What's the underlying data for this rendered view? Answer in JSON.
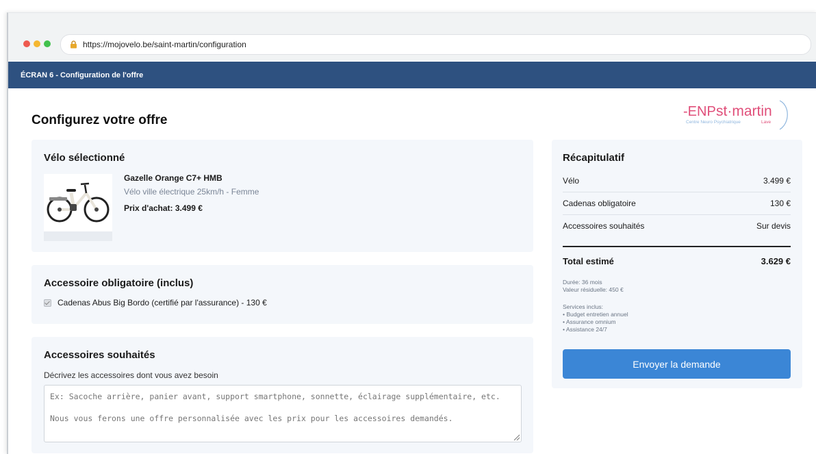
{
  "browser": {
    "url": "https://mojovelo.be/saint-martin/configuration"
  },
  "header": {
    "screen_label": "ÉCRAN 6 - Configuration de l'offre"
  },
  "logo": {
    "prefix": "-ENP",
    "name": "st·martin",
    "tagline_part1": "Centre Neuro Psychiatrique",
    "tagline_part2": "Lave",
    "color_prefix": "#e04f7a",
    "color_name": "#e04f7a",
    "color_tagline": "#8fb6de"
  },
  "page": {
    "title": "Configurez votre offre"
  },
  "bike": {
    "heading": "Vélo sélectionné",
    "name": "Gazelle Orange C7+ HMB",
    "subtitle": "Vélo ville électrique 25km/h - Femme",
    "price": "Prix d'achat: 3.499 €"
  },
  "required_accessory": {
    "heading": "Accessoire obligatoire (inclus)",
    "item": "Cadenas Abus Big Bordo (certifié par l'assurance) - 130 €",
    "checked": true
  },
  "wished_accessories": {
    "heading": "Accessoires souhaités",
    "label": "Décrivez les accessoires dont vous avez besoin",
    "placeholder": "Ex: Sacoche arrière, panier avant, support smartphone, sonnette, éclairage supplémentaire, etc.\n\nNous vous ferons une offre personnalisée avec les prix pour les accessoires demandés."
  },
  "summary": {
    "heading": "Récapitulatif",
    "rows": [
      {
        "label": "Vélo",
        "value": "3.499 €"
      },
      {
        "label": "Cadenas obligatoire",
        "value": "130 €"
      },
      {
        "label": "Accessoires souhaités",
        "value": "Sur devis"
      }
    ],
    "total_label": "Total estimé",
    "total_value": "3.629 €",
    "duration": "Durée: 36 mois",
    "residual": "Valeur résiduelle: 450 €",
    "services_title": "Services inclus:",
    "services": [
      "• Budget entretien annuel",
      "• Assurance omnium",
      "• Assistance 24/7"
    ],
    "send_label": "Envoyer la demande",
    "accent_color": "#3b86d6"
  },
  "colors": {
    "topbar": "#2e5180",
    "panel_bg": "#f4f7fb"
  }
}
